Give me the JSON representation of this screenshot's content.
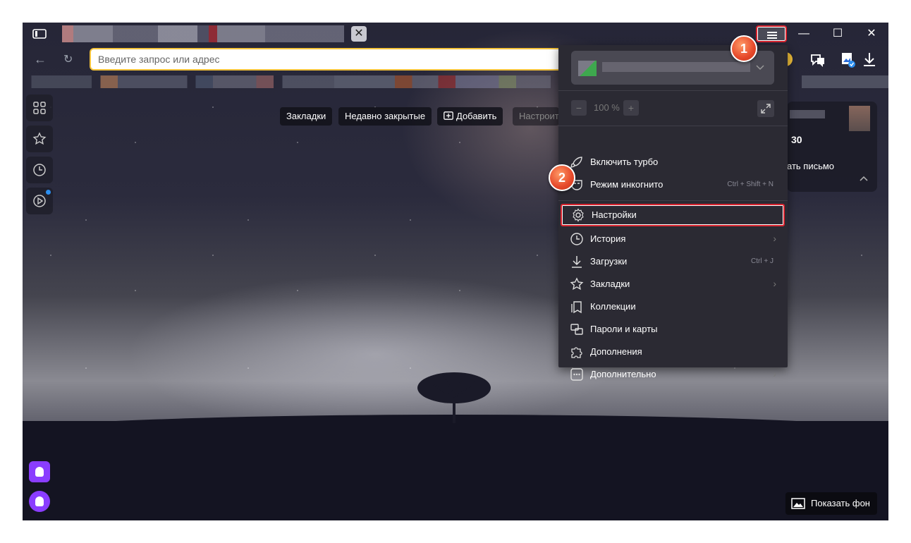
{
  "address": {
    "placeholder": "Введите запрос или адрес"
  },
  "bookmark_bar": {
    "bookmarks": "Закладки",
    "recently_closed": "Недавно закрытые",
    "add": "Добавить",
    "customize": "Настроить"
  },
  "widget": {
    "count": "30",
    "text": "ать письмо"
  },
  "menu": {
    "zoom": "100 %",
    "items": [
      {
        "label": "Включить турбо",
        "shortcut": "",
        "submenu": false,
        "icon": "rocket-icon"
      },
      {
        "label": "Режим инкогнито",
        "shortcut": "Ctrl + Shift + N",
        "submenu": false,
        "icon": "incognito-mask-icon"
      },
      {
        "label": "Настройки",
        "shortcut": "",
        "submenu": false,
        "icon": "gear-icon"
      },
      {
        "label": "История",
        "shortcut": "",
        "submenu": true,
        "icon": "clock-icon"
      },
      {
        "label": "Загрузки",
        "shortcut": "Ctrl + J",
        "submenu": false,
        "icon": "download-icon"
      },
      {
        "label": "Закладки",
        "shortcut": "",
        "submenu": true,
        "icon": "star-icon"
      },
      {
        "label": "Коллекции",
        "shortcut": "",
        "submenu": false,
        "icon": "collections-icon"
      },
      {
        "label": "Пароли и карты",
        "shortcut": "",
        "submenu": false,
        "icon": "key-card-icon"
      },
      {
        "label": "Дополнения",
        "shortcut": "",
        "submenu": false,
        "icon": "puzzle-icon"
      },
      {
        "label": "Дополнительно",
        "shortcut": "",
        "submenu": true,
        "icon": "more-dots-icon"
      }
    ]
  },
  "annotations": {
    "step1": "1",
    "step2": "2"
  },
  "show_background": "Показать фон",
  "colors": {
    "highlight_red": "#d9232e",
    "accent_yellow": "#f5c33b",
    "menu_bg": "#2b2a33",
    "alice_purple": "#8a3dff"
  }
}
